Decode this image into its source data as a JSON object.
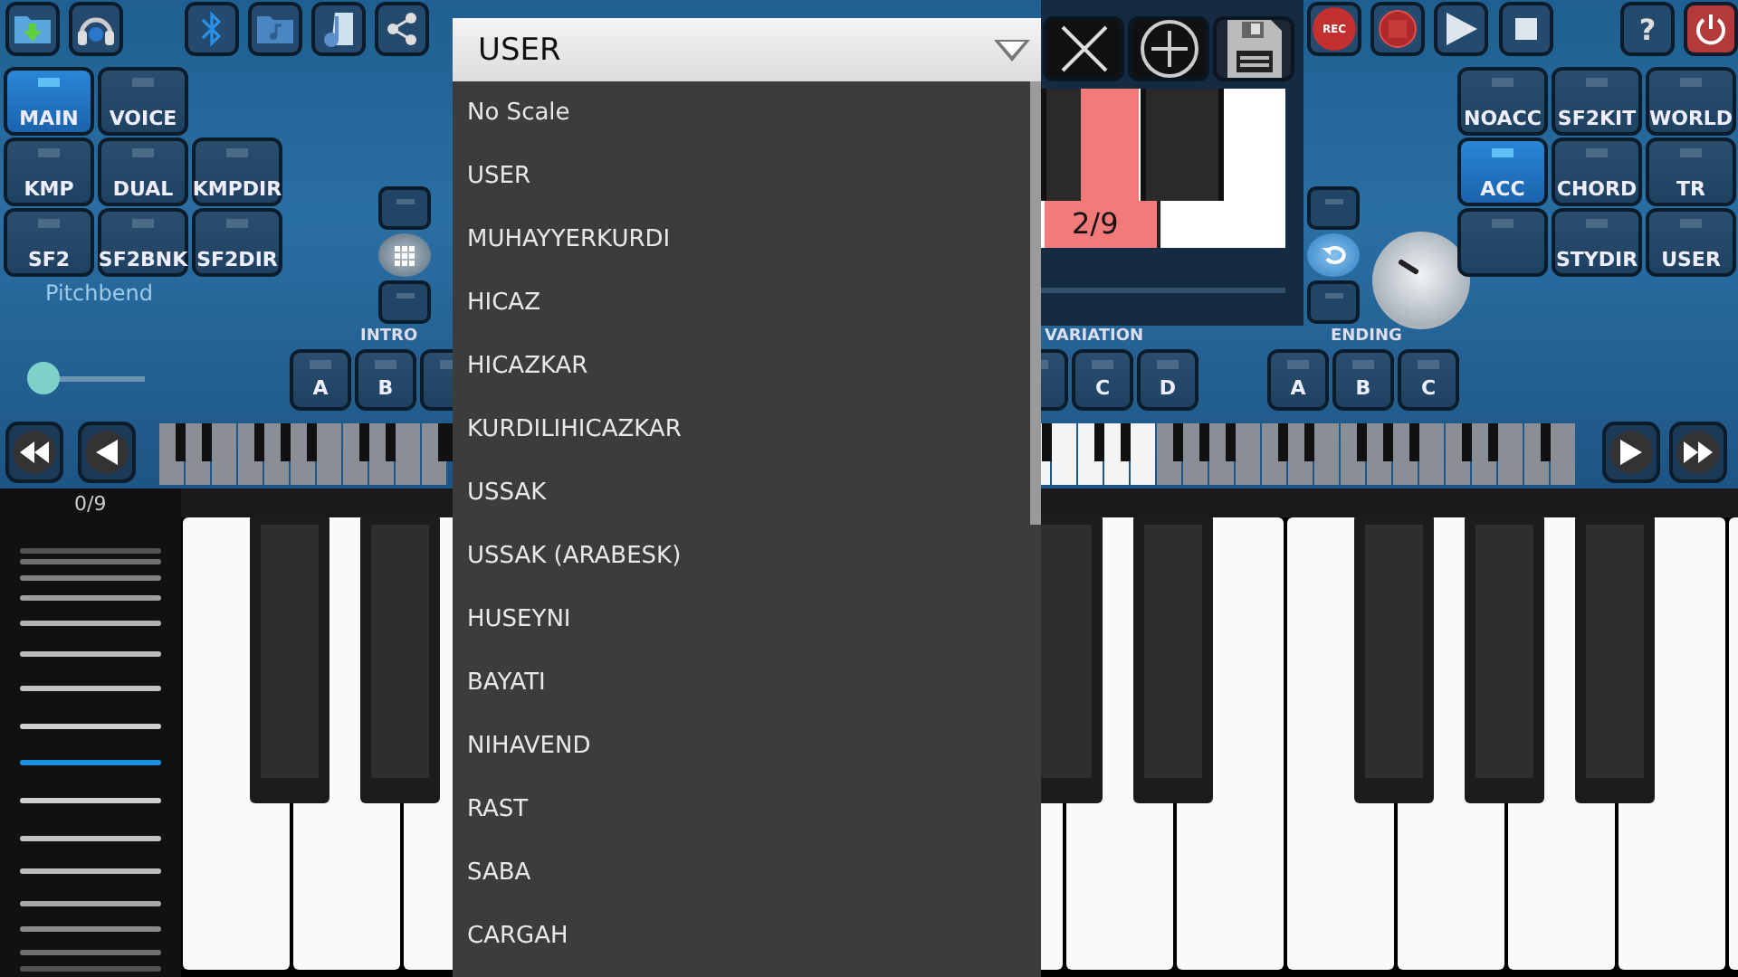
{
  "bank_buttons": [
    [
      {
        "label": "MAIN",
        "selected": true
      },
      {
        "label": "VOICE",
        "selected": false
      }
    ],
    [
      {
        "label": "KMP",
        "selected": false
      },
      {
        "label": "DUAL",
        "selected": false
      },
      {
        "label": "KMPDIR",
        "selected": false
      }
    ],
    [
      {
        "label": "SF2",
        "selected": false
      },
      {
        "label": "SF2BNK",
        "selected": false
      },
      {
        "label": "SF2DIR",
        "selected": false
      }
    ]
  ],
  "pitchbend": {
    "label": "Pitchbend",
    "level": 0
  },
  "intro": {
    "label": "INTRO",
    "buttons": [
      "A",
      "B"
    ]
  },
  "variation": {
    "label": "VARIATION",
    "buttons": [
      "C",
      "D"
    ]
  },
  "ending": {
    "label": "ENDING",
    "buttons": [
      "A",
      "B",
      "C"
    ]
  },
  "chord_display": {
    "label": "2/9"
  },
  "rec_button": {
    "label": "REC"
  },
  "help_button": {
    "label": "?"
  },
  "style_buttons": [
    [
      {
        "label": "NOACC",
        "selected": false
      },
      {
        "label": "SF2KIT",
        "selected": false
      },
      {
        "label": "WORLD",
        "selected": false
      }
    ],
    [
      {
        "label": "ACC",
        "selected": true
      },
      {
        "label": "CHORD",
        "selected": false
      },
      {
        "label": "TR",
        "selected": false
      }
    ],
    [
      {
        "selected": false
      },
      {
        "label": "STYDIR",
        "selected": false
      },
      {
        "label": "USER",
        "selected": false
      }
    ]
  ],
  "octave_panel": {
    "label": "0/9",
    "lines": [
      {
        "selected": false
      },
      {
        "selected": false
      },
      {
        "selected": false
      },
      {
        "selected": false
      },
      {
        "selected": false
      },
      {
        "selected": false
      },
      {
        "selected": false
      },
      {
        "selected": false
      },
      {
        "selected": true
      },
      {
        "selected": false
      },
      {
        "selected": false
      },
      {
        "selected": false
      },
      {
        "selected": false
      },
      {
        "selected": false
      },
      {
        "selected": false
      },
      {
        "selected": false
      }
    ]
  },
  "scale_dropdown": {
    "value": "USER",
    "options": [
      "No Scale",
      "USER",
      "MUHAYYERKURDI",
      "HICAZ",
      "HICAZKAR",
      "KURDILIHICAZKAR",
      "USSAK",
      "USSAK (ARABESK)",
      "HUSEYNI",
      "BAYATI",
      "NIHAVEND",
      "RAST",
      "SABA",
      "CARGAH"
    ]
  }
}
